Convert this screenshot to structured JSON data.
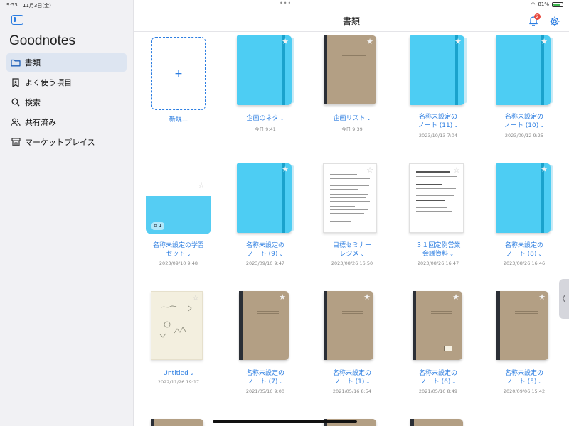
{
  "status_bar": {
    "time": "9:53",
    "date": "11月3日(金)",
    "battery": "81%"
  },
  "app": {
    "title": "Goodnotes"
  },
  "sidebar": {
    "items": [
      {
        "label": "書類",
        "icon": "folder-icon",
        "active": true
      },
      {
        "label": "よく使う項目",
        "icon": "bookmark-star-icon",
        "active": false
      },
      {
        "label": "検索",
        "icon": "search-icon",
        "active": false
      },
      {
        "label": "共有済み",
        "icon": "people-icon",
        "active": false
      },
      {
        "label": "マーケットプレイス",
        "icon": "store-icon",
        "active": false
      }
    ]
  },
  "header": {
    "title": "書類",
    "notification_count": "2"
  },
  "new_document": {
    "label": "新規..."
  },
  "documents": [
    {
      "title": "企画のネタ",
      "date": "今日 9:41",
      "cover": "blue"
    },
    {
      "title": "企画リスト",
      "date": "今日 9:39",
      "cover": "brown"
    },
    {
      "title": "名称未設定の\nノート (11)",
      "date": "2023/10/13 7:04",
      "cover": "blue"
    },
    {
      "title": "名称未設定の\nノート (10)",
      "date": "2023/09/12 9:25",
      "cover": "blue"
    },
    {
      "title": "名称未設定の学習\nセット",
      "date": "2023/09/10 9:48",
      "cover": "folder",
      "count": "1"
    },
    {
      "title": "名称未設定の\nノート (9)",
      "date": "2023/09/10 9:47",
      "cover": "blue"
    },
    {
      "title": "目標セミナー\nレジメ",
      "date": "2023/08/26 16:50",
      "cover": "paper"
    },
    {
      "title": "３１回定例営業\n会議資料",
      "date": "2023/08/26 16:47",
      "cover": "paper"
    },
    {
      "title": "名称未設定の\nノート (8)",
      "date": "2023/08/26 16:46",
      "cover": "blue"
    },
    {
      "title": "Untitled",
      "date": "2022/11/26 19:17",
      "cover": "cream"
    },
    {
      "title": "名称未設定の\nノート (7)",
      "date": "2021/05/16 9:00",
      "cover": "brown"
    },
    {
      "title": "名称未設定の\nノート (1)",
      "date": "2021/05/16 8:54",
      "cover": "brown"
    },
    {
      "title": "名称未設定の\nノート (6)",
      "date": "2021/05/16 8:49",
      "cover": "brown"
    },
    {
      "title": "名称未設定の\nノート (5)",
      "date": "2020/09/06 15:42",
      "cover": "brown"
    }
  ]
}
